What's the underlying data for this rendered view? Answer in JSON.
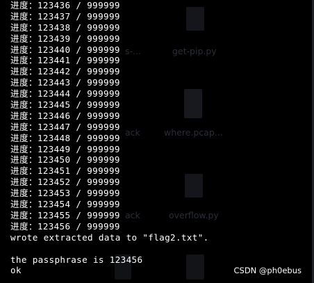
{
  "terminal": {
    "progress_lines": [
      "进度：123436 / 999999",
      "进度：123437 / 999999",
      "进度：123438 / 999999",
      "进度：123439 / 999999",
      "进度：123440 / 999999",
      "进度：123441 / 999999",
      "进度：123442 / 999999",
      "进度：123443 / 999999",
      "进度：123444 / 999999",
      "进度：123445 / 999999",
      "进度：123446 / 999999",
      "进度：123447 / 999999",
      "进度：123448 / 999999",
      "进度：123449 / 999999",
      "进度：123450 / 999999",
      "进度：123451 / 999999",
      "进度：123452 / 999999",
      "进度：123453 / 999999",
      "进度：123454 / 999999",
      "进度：123455 / 999999",
      "进度：123456 / 999999"
    ],
    "wrote_line": "wrote extracted data to \"flag2.txt\".",
    "passphrase_line": "the passphrase is 123456",
    "ok_line": "ok"
  },
  "desktop_ghost": {
    "labels": [
      "get-pip.py",
      "where.pcap...",
      "overflow.py",
      "ack",
      "ack",
      "s-..."
    ]
  },
  "watermark": "CSDN @ph0ebus",
  "colors": {
    "background": "#000000",
    "text": "#ffffff",
    "ghost": "#2a2e38"
  }
}
